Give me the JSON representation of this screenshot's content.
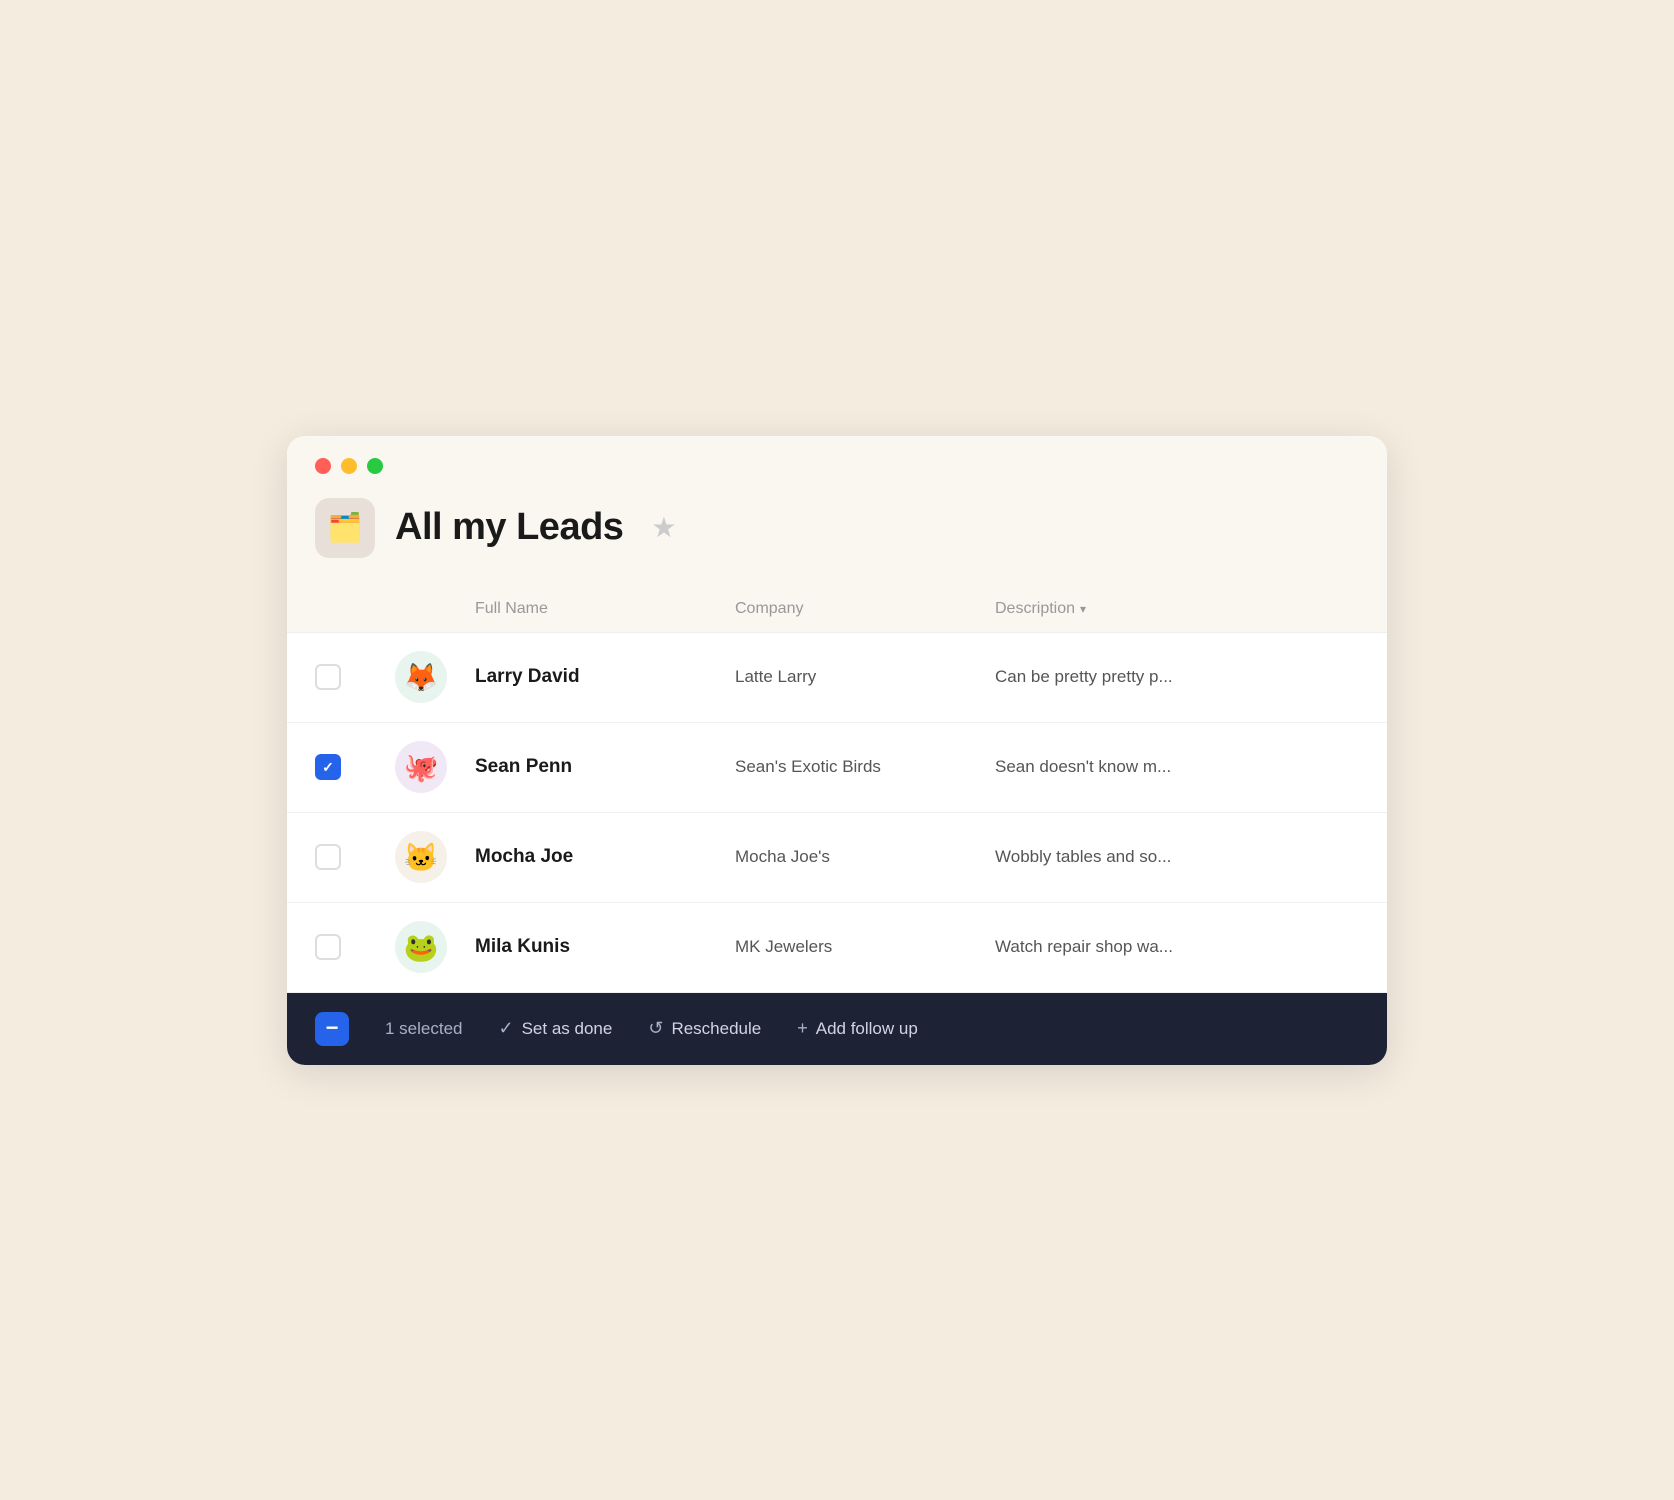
{
  "window": {
    "traffic_lights": [
      "red",
      "yellow",
      "green"
    ],
    "header": {
      "icon": "🗂️",
      "title": "All my Leads",
      "star_label": "★"
    },
    "columns": [
      {
        "label": "",
        "key": "checkbox_col"
      },
      {
        "label": "",
        "key": "avatar_col"
      },
      {
        "label": "Full Name",
        "key": "name"
      },
      {
        "label": "Company",
        "key": "company"
      },
      {
        "label": "Description",
        "key": "description",
        "has_chevron": true
      }
    ],
    "rows": [
      {
        "id": 1,
        "checked": false,
        "avatar_emoji": "🦊",
        "avatar_class": "fox",
        "name": "Larry David",
        "company": "Latte Larry",
        "description": "Can be pretty pretty p..."
      },
      {
        "id": 2,
        "checked": true,
        "avatar_emoji": "🐙",
        "avatar_class": "octopus",
        "name": "Sean Penn",
        "company": "Sean's Exotic Birds",
        "description": "Sean doesn't know m..."
      },
      {
        "id": 3,
        "checked": false,
        "avatar_emoji": "🐱",
        "avatar_class": "cat",
        "name": "Mocha Joe",
        "company": "Mocha Joe's",
        "description": "Wobbly tables and so..."
      },
      {
        "id": 4,
        "checked": false,
        "avatar_emoji": "🐸",
        "avatar_class": "frog",
        "name": "Mila Kunis",
        "company": "MK Jewelers",
        "description": "Watch repair shop wa..."
      }
    ],
    "bottom_bar": {
      "selected_count": "1 selected",
      "actions": [
        {
          "icon": "✓",
          "label": "Set as done"
        },
        {
          "icon": "↺",
          "label": "Reschedule"
        },
        {
          "icon": "+",
          "label": "Add follow up"
        }
      ]
    }
  }
}
